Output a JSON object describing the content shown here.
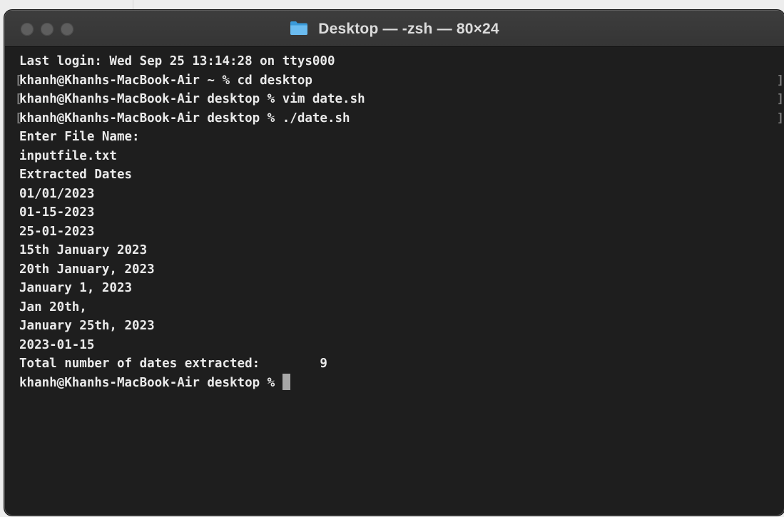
{
  "window": {
    "title": "Desktop — -zsh — 80×24",
    "title_icon": "folder-icon",
    "traffic_light_color": "#5e5e5e"
  },
  "terminal": {
    "background": "#1e1e1e",
    "foreground": "#eaeaea",
    "lines": [
      "Last login: Wed Sep 25 13:14:28 on ttys000",
      "khanh@Khanhs-MacBook-Air ~ % cd desktop",
      "khanh@Khanhs-MacBook-Air desktop % vim date.sh",
      "khanh@Khanhs-MacBook-Air desktop % ./date.sh",
      "Enter File Name:",
      "inputfile.txt",
      "Extracted Dates",
      "01/01/2023",
      "01-15-2023",
      "25-01-2023",
      "15th January 2023",
      "20th January, 2023",
      "January 1, 2023",
      "Jan 20th,",
      "January 25th, 2023",
      "2023-01-15",
      "Total number of dates extracted:        9"
    ],
    "prompt": "khanh@Khanhs-MacBook-Air desktop % ",
    "marks": {
      "left_bracket": "[",
      "right_bracket": "]"
    }
  }
}
